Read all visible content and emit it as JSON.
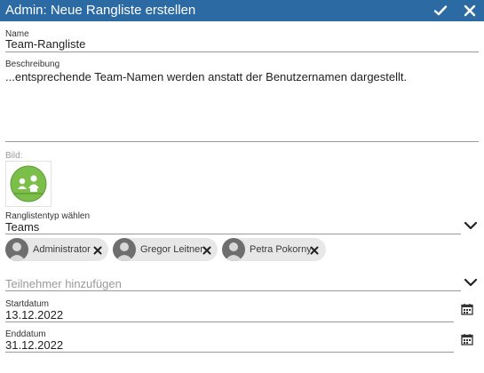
{
  "window": {
    "title": "Admin: Neue Rangliste erstellen",
    "confirm_icon": "checkmark-icon",
    "close_icon": "close-icon"
  },
  "form": {
    "name": {
      "label": "Name",
      "value": "Team-Rangliste"
    },
    "description": {
      "label": "Beschreibung",
      "value": "...entsprechende Team-Namen werden anstatt der Benutzernamen dargestellt."
    },
    "image": {
      "label": "Bild:",
      "icon": "team-group-image-icon"
    },
    "ranking_type": {
      "label": "Ranglistentyp wählen",
      "value": "Teams",
      "icon": "chevron-down-icon"
    },
    "participants": [
      {
        "name": "Administrator"
      },
      {
        "name": "Gregor Leitner"
      },
      {
        "name": "Petra Pokorny"
      }
    ],
    "add_participants": {
      "placeholder": "Teilnehmer hinzufügen",
      "icon": "chevron-down-icon"
    },
    "start_date": {
      "label": "Startdatum",
      "value": "13.12.2022",
      "icon": "calendar-icon"
    },
    "end_date": {
      "label": "Enddatum",
      "value": "31.12.2022",
      "icon": "calendar-icon"
    }
  },
  "colors": {
    "title_bar": "#2b6aa3",
    "chip_bg": "#e7e7e7",
    "image_green": "#7bbf4a"
  }
}
